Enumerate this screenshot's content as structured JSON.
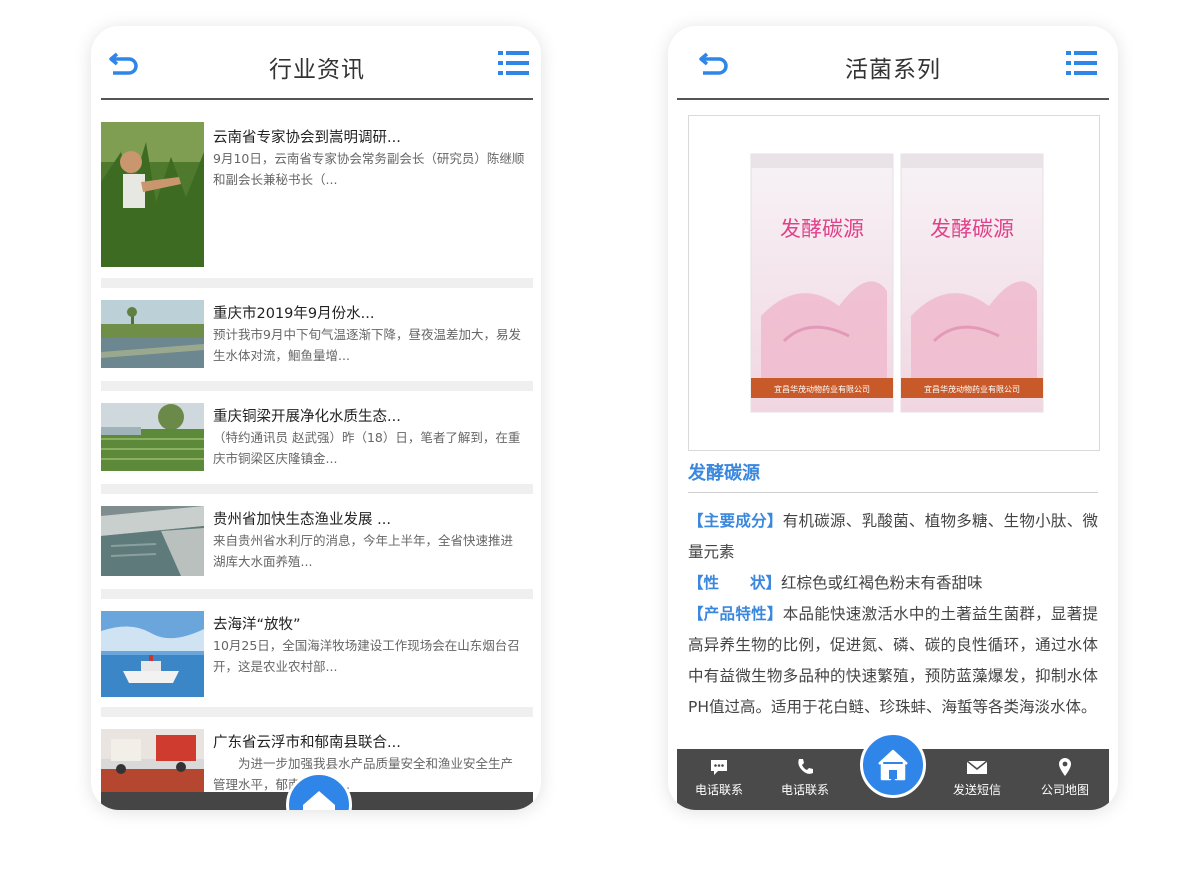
{
  "left": {
    "title": "行业资讯",
    "news": [
      {
        "title": "云南省专家协会到嵩明调研...",
        "desc": "9月10日，云南省专家协会常务副会长（研究员）陈继顺和副会长兼秘书长（..."
      },
      {
        "title": "重庆市2019年9月份水...",
        "desc": "预计我市9月中下旬气温逐渐下降，昼夜温差加大，易发生水体对流，鮰鱼量增..."
      },
      {
        "title": "重庆铜梁开展净化水质生态...",
        "desc": "（特约通讯员 赵武强）昨（18）日，笔者了解到，在重庆市铜梁区庆隆镇金..."
      },
      {
        "title": "贵州省加快生态渔业发展 ...",
        "desc": "来自贵州省水利厅的消息，今年上半年，全省快速推进湖库大水面养殖..."
      },
      {
        "title": "去海洋“放牧”",
        "desc": "10月25日，全国海洋牧场建设工作现场会在山东烟台召开，这是农业农村部..."
      },
      {
        "title": "广东省云浮市和郁南县联合...",
        "desc": "为进一步加强我县水产品质量安全和渔业安全生产管理水平，郁南县水产..."
      }
    ]
  },
  "right": {
    "title": "活菌系列",
    "product": {
      "name": "发酵碳源",
      "bag_text": "发酵碳源",
      "company": "宜昌华茂动物药业有限公司",
      "p1_key": "【主要成分】",
      "p1_val": "有机碳源、乳酸菌、植物多糖、生物小肽、微量元素",
      "p2_key": "【性　　状】",
      "p2_val": "红棕色或红褐色粉末有香甜味",
      "p3_key": "【产品特性】",
      "p3_val": "本品能快速激活水中的土著益生菌群，显著提高异养生物的比例，促进氮、磷、碳的良性循环，通过水体中有益微生物多品种的快速繁殖，预防蓝藻爆发，抑制水体PH值过高。适用于花白鲢、珍珠蚌、海蜇等各类海淡水体。"
    },
    "tabs": [
      {
        "label": "电话联系",
        "icon": "chat-icon"
      },
      {
        "label": "电话联系",
        "icon": "phone-icon"
      },
      {
        "label": "发送短信",
        "icon": "mail-icon"
      },
      {
        "label": "公司地图",
        "icon": "map-pin-icon"
      }
    ]
  },
  "colors": {
    "accent": "#3a87de",
    "home": "#2f86e8",
    "tabbar": "#4a4a4a"
  }
}
